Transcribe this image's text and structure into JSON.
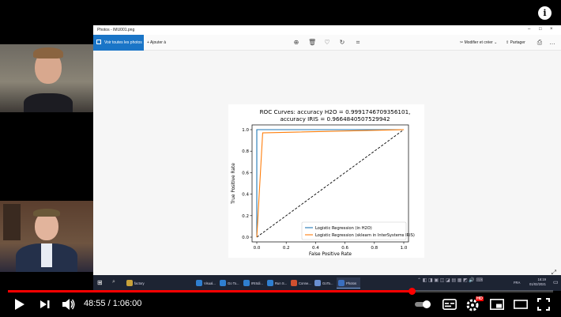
{
  "window": {
    "title": "Photos - IMU001.png"
  },
  "toolbar": {
    "all_photos_label": "Voir toutes les photos",
    "add_label": "Ajouter à",
    "edit_label": "Modifier et créer",
    "share_label": "Partager"
  },
  "chart_data": {
    "type": "line",
    "title": "ROC Curves: accuracy H2O = 0.9991746709356101,",
    "subtitle": "accuracy IRIS = 0.9664840507529942",
    "xlabel": "False Positive Rate",
    "ylabel": "True Positive Rate",
    "xlim": [
      0.0,
      1.0
    ],
    "ylim": [
      0.0,
      1.0
    ],
    "xticks": [
      "0.0",
      "0.2",
      "0.4",
      "0.6",
      "0.8",
      "1.0"
    ],
    "yticks": [
      "0.0",
      "0.2",
      "0.4",
      "0.6",
      "0.8",
      "1.0"
    ],
    "legend_position": "bottom-right",
    "series": [
      {
        "name": "Logistic Regression (in H2O)",
        "color": "#1f77b4",
        "x": [
          0.0,
          0.0,
          1.0
        ],
        "y": [
          0.0,
          1.0,
          1.0
        ]
      },
      {
        "name": "Logistic Regression (sklearn in InterSystems IRIS)",
        "color": "#ff7f0e",
        "x": [
          0.0,
          0.04,
          1.0
        ],
        "y": [
          0.0,
          0.97,
          1.0
        ]
      }
    ],
    "reference_line": {
      "x": [
        0.0,
        1.0
      ],
      "y": [
        0.0,
        1.0
      ],
      "style": "dashed",
      "color": "#000000"
    }
  },
  "taskbar": {
    "apps": [
      {
        "label": "factory",
        "color": "#c8a23a"
      },
      {
        "label": "Visual...",
        "color": "#2f7fd0"
      },
      {
        "label": "Go To...",
        "color": "#2f7fd0"
      },
      {
        "label": "IRISdi...",
        "color": "#2f7fd0"
      },
      {
        "label": "Run S...",
        "color": "#2f7fd0"
      },
      {
        "label": "Conne...",
        "color": "#d0502f"
      },
      {
        "label": "GoTo...",
        "color": "#6a8fd0"
      },
      {
        "label": "Photos",
        "color": "#3a6fc0"
      }
    ],
    "lang": "FRA",
    "time": "16:19",
    "date": "01/02/2021"
  },
  "player": {
    "current_time": "48:55",
    "separator": "/",
    "duration": "1:06:00",
    "progress_fraction": 0.741,
    "hd_badge": "HD"
  }
}
